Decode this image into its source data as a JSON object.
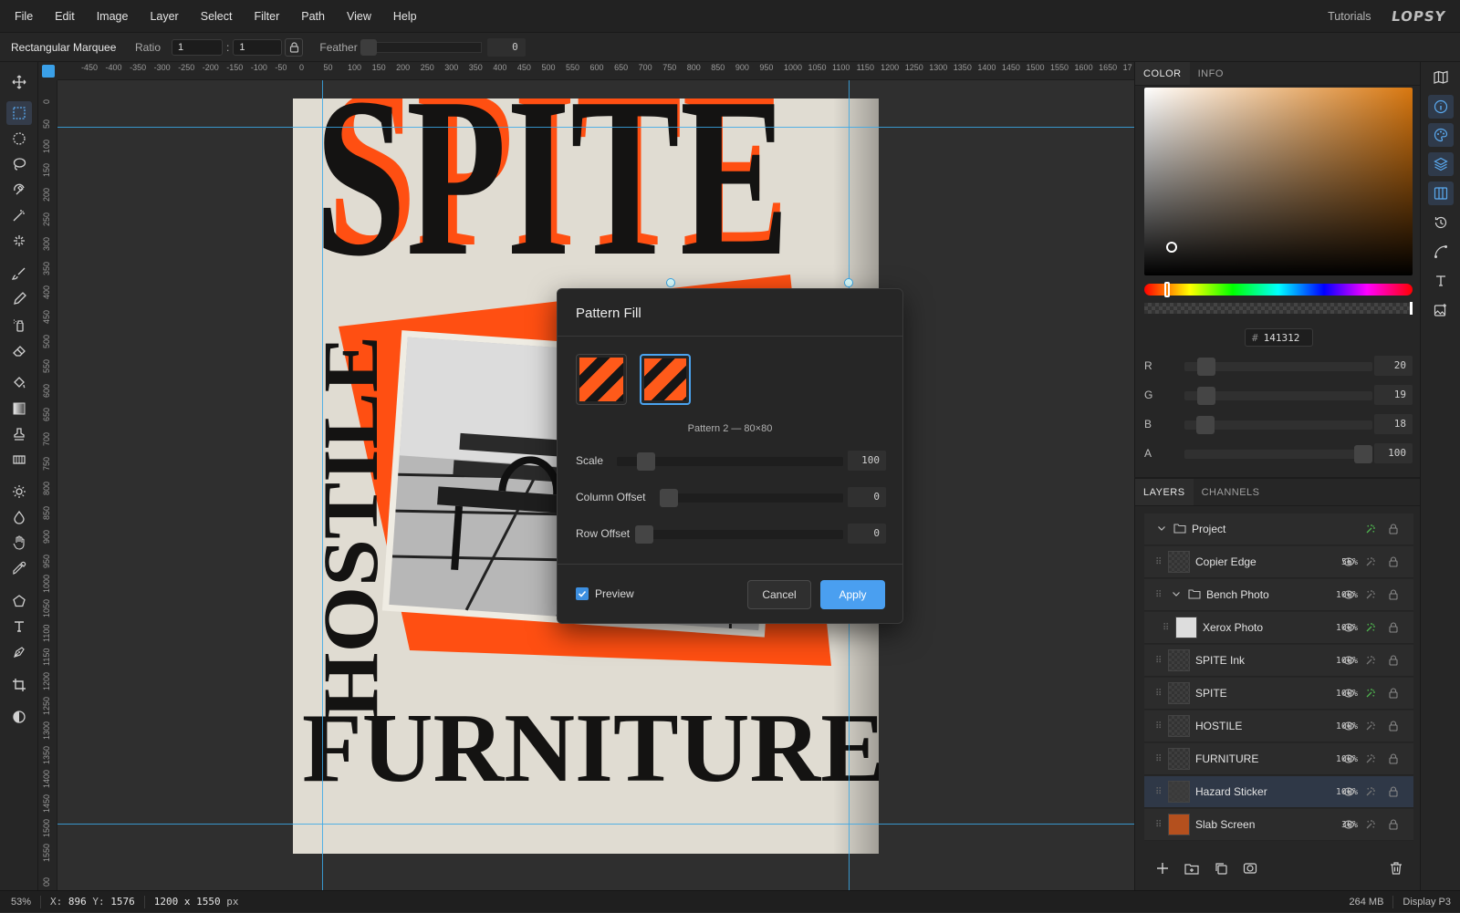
{
  "menu": [
    "File",
    "Edit",
    "Image",
    "Layer",
    "Select",
    "Filter",
    "Path",
    "View",
    "Help"
  ],
  "header": {
    "tutorials": "Tutorials",
    "logo": "LOPSY"
  },
  "options": {
    "tool_name": "Rectangular Marquee",
    "ratio_label": "Ratio",
    "ratio_w": "1",
    "ratio_sep": ":",
    "ratio_h": "1",
    "feather_label": "Feather",
    "feather_value": "0"
  },
  "ruler_h": [
    "-450",
    "-400",
    "-350",
    "-300",
    "-250",
    "-200",
    "-150",
    "-100",
    "-50",
    "0",
    "50",
    "100",
    "150",
    "200",
    "250",
    "300",
    "350",
    "400",
    "450",
    "500",
    "550",
    "600",
    "650",
    "700",
    "750",
    "800",
    "850",
    "900",
    "950",
    "1000",
    "1050",
    "1100",
    "1150",
    "1200",
    "1250",
    "1300",
    "1350",
    "1400",
    "1450",
    "1500",
    "1550",
    "1600",
    "1650",
    "17"
  ],
  "ruler_v": [
    "0",
    "50",
    "100",
    "150",
    "200",
    "250",
    "300",
    "350",
    "400",
    "450",
    "500",
    "550",
    "600",
    "650",
    "700",
    "750",
    "800",
    "850",
    "900",
    "950",
    "1000",
    "1050",
    "1100",
    "1150",
    "1200",
    "1250",
    "1300",
    "1350",
    "1400",
    "1450",
    "1500",
    "1550",
    "00"
  ],
  "artwork": {
    "title_top": "SPITE",
    "title_side": "HOSTILE",
    "title_bottom": "FURNITURE"
  },
  "color_panel": {
    "tabs": [
      "COLOR",
      "INFO"
    ],
    "hex_hash": "#",
    "hex": "141312",
    "channels": [
      {
        "label": "R",
        "value": "20"
      },
      {
        "label": "G",
        "value": "19"
      },
      {
        "label": "B",
        "value": "18"
      },
      {
        "label": "A",
        "value": "100"
      }
    ]
  },
  "layers_panel": {
    "tabs": [
      "LAYERS",
      "CHANNELS"
    ],
    "layers": [
      {
        "name": "Project",
        "opacity": "",
        "type": "group",
        "fx": true
      },
      {
        "name": "Copier Edge",
        "opacity": "55%",
        "type": "layer",
        "fx": false
      },
      {
        "name": "Bench Photo",
        "opacity": "100%",
        "type": "group",
        "fx": false
      },
      {
        "name": "Xerox Photo",
        "opacity": "100%",
        "type": "image",
        "fx": true
      },
      {
        "name": "SPITE Ink",
        "opacity": "100%",
        "type": "layer",
        "fx": false
      },
      {
        "name": "SPITE",
        "opacity": "100%",
        "type": "layer",
        "fx": true
      },
      {
        "name": "HOSTILE",
        "opacity": "100%",
        "type": "layer",
        "fx": false
      },
      {
        "name": "FURNITURE",
        "opacity": "100%",
        "type": "layer",
        "fx": false
      },
      {
        "name": "Hazard Sticker",
        "opacity": "100%",
        "type": "layer",
        "fx": false
      },
      {
        "name": "Slab Screen",
        "opacity": "30%",
        "type": "layer",
        "fx": false
      }
    ]
  },
  "dialog": {
    "title": "Pattern Fill",
    "caption": "Pattern 2 — 80×80",
    "rows": [
      {
        "label": "Scale",
        "value": "100"
      },
      {
        "label": "Column Offset",
        "value": "0"
      },
      {
        "label": "Row Offset",
        "value": "0"
      }
    ],
    "preview_label": "Preview",
    "preview_checked": true,
    "cancel": "Cancel",
    "apply": "Apply"
  },
  "status": {
    "zoom": "53%",
    "x_label": "X:",
    "x": "896",
    "y_label": "Y:",
    "y": "1576",
    "size_value": "1200 x 1550",
    "size_unit": "px",
    "memory": "264 MB",
    "profile": "Display P3"
  },
  "colors": {
    "accent": "#4a9ff0",
    "orange": "#ff5a1a",
    "ink": "#141312",
    "paper": "#e0dcd2",
    "fx_green": "#4fb54f"
  }
}
